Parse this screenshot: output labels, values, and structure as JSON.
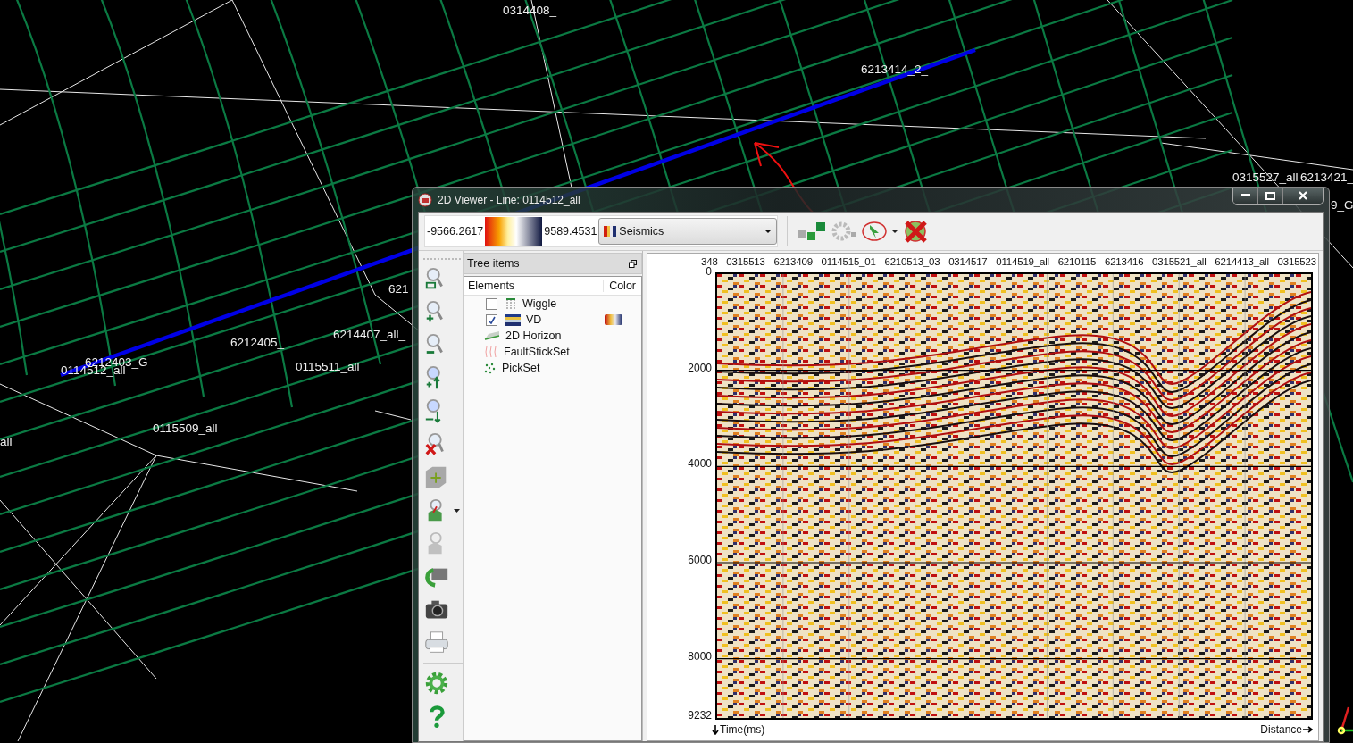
{
  "scene": {
    "labels": [
      "0314408_",
      "6213414_2_",
      "621",
      "6214407_all_",
      "6212405_",
      "6212403_G",
      "0114512_all",
      "0115511_all",
      "0115509_all",
      "all",
      "0315527_all",
      "6213421_",
      "9_G"
    ]
  },
  "window": {
    "title": "2D Viewer - Line: 0114512_all"
  },
  "color_range": {
    "min": "-9566.2617",
    "max": "9589.4531",
    "colortable": "Seismics"
  },
  "tree": {
    "title": "Tree items",
    "columns": [
      "Elements",
      "Color"
    ],
    "items": [
      {
        "label": "Wiggle",
        "kind": "wiggle",
        "checked": false
      },
      {
        "label": "VD",
        "kind": "vd",
        "checked": true
      },
      {
        "label": "2D Horizon",
        "kind": "horizon"
      },
      {
        "label": "FaultStickSet",
        "kind": "faults"
      },
      {
        "label": "PickSet",
        "kind": "picks"
      }
    ]
  },
  "plot": {
    "top_labels": [
      "348",
      "0315513",
      "6213409",
      "0114515_01",
      "6210513_03",
      "0314517",
      "0114519_all",
      "6210115",
      "6213416",
      "0315521_all",
      "6214413_all",
      "0315523"
    ],
    "y_ticks": [
      "0",
      "2000",
      "4000",
      "6000",
      "8000",
      "9232"
    ],
    "y_axis_label": "Time(ms)",
    "x_axis_label": "Distance"
  }
}
